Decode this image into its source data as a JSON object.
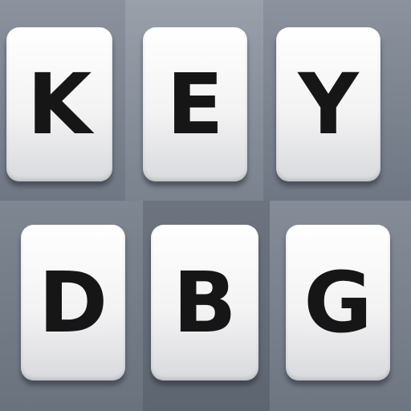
{
  "keyboard": {
    "row1": [
      "K",
      "E",
      "Y"
    ],
    "row2": [
      "D",
      "B",
      "G"
    ]
  }
}
